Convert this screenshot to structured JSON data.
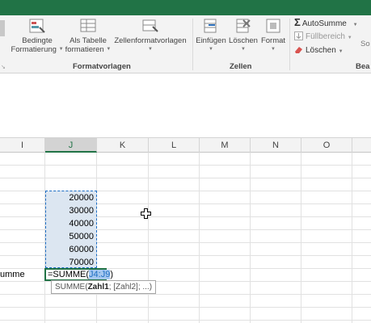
{
  "ribbon": {
    "buttons": {
      "bedingte_line1": "Bedingte",
      "bedingte_line2": "Formatierung",
      "tabelle_line1": "Als Tabelle",
      "tabelle_line2": "formatieren",
      "zellformat": "Zellenformatvorlagen",
      "einfuegen": "Einfügen",
      "loeschen": "Löschen",
      "format": "Format",
      "cut_off": "So"
    },
    "groups": {
      "formatvorlagen": "Formatvorlagen",
      "zellen": "Zellen",
      "bearbeiten_cut": "Bea"
    },
    "editing": {
      "autosumme": "AutoSumme",
      "fuellbereich": "Füllbereich",
      "loeschen": "Löschen"
    }
  },
  "columns": [
    "I",
    "J",
    "K",
    "L",
    "M",
    "N",
    "O"
  ],
  "selected_column": "J",
  "cells": {
    "values": [
      "20000",
      "30000",
      "40000",
      "50000",
      "60000",
      "70000"
    ],
    "row_label": "umme",
    "formula_prefix": "=SUMME(",
    "formula_ref": "J4:J9",
    "formula_suffix": ")"
  },
  "tooltip": {
    "func": "SUMME(",
    "arg1": "Zahl1",
    "rest": "; [Zahl2]; ...)"
  },
  "colors": {
    "excel_green": "#217346",
    "selection_fill": "#dce6f1",
    "marching_ants": "#1e6ec4"
  }
}
